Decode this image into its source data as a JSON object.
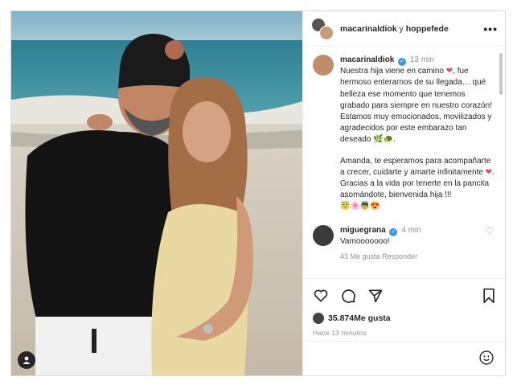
{
  "header": {
    "user1": "macarinaldiok",
    "connector": " y ",
    "user2": "hoppefede",
    "more_label": "•••"
  },
  "caption": {
    "username": "macarinaldiok",
    "time": "13 min",
    "line1": "Nuestra hija viene en camino",
    "line1b": ", fue hermoso enterarnos de su llegada… qué belleza ese momento que tenemos grabado para siempre en nuestro corazón!",
    "line2": "Estamos muy emocionados, movilizados y agradecidos por este embarazo tan deseado",
    "line2_emoji": "🌿🐢.",
    "line3": "Amanda, te esperamos para acompañarte a crecer, cuidarte y amarte infinitamente",
    "line3_end": ".",
    "line4": "Gracias a la vida por tenerte en la pancita asomándote, bienvenida hija !!!",
    "line5_emoji": "😇🌸👼😍"
  },
  "comment": {
    "username": "miguegrana",
    "time": "4 min",
    "text": "Vamooooooo!",
    "meta": "43 Me gusta    Responder"
  },
  "likes": {
    "count": "35.874",
    "label": " Me gusta"
  },
  "timestamp": "Hace 13 minutos",
  "colors": {
    "verified": "#3897f0",
    "heart": "#ed4956"
  },
  "icons": [
    "tag-user-icon",
    "heart-icon",
    "comment-icon",
    "share-icon",
    "bookmark-icon",
    "emoji-icon",
    "more-icon",
    "verified-icon"
  ]
}
